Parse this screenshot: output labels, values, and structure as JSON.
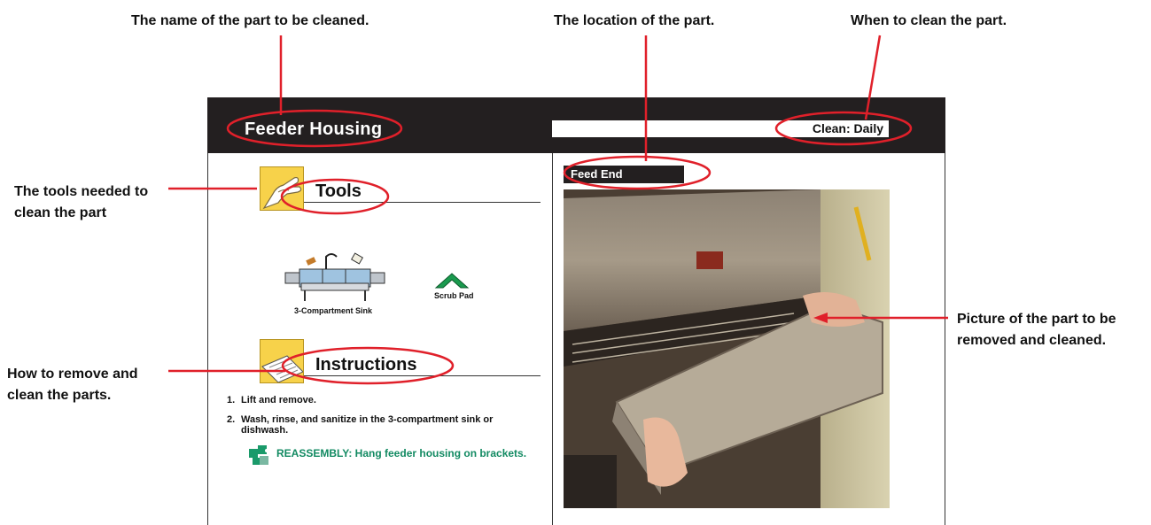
{
  "callouts": {
    "part_name": "The name of the part to be cleaned.",
    "location": "The location of the part.",
    "when": "When to clean the part.",
    "tools_line1": "The tools needed to",
    "tools_line2": "clean the part",
    "how_line1": "How to remove and",
    "how_line2": "clean the parts.",
    "picture_line1": "Picture of the part to be",
    "picture_line2": "removed and cleaned."
  },
  "card": {
    "title": "Feeder Housing",
    "clean": "Clean: Daily",
    "location_label": "Feed End",
    "tools_heading": "Tools",
    "tools": [
      "3-Compartment Sink",
      "Scrub Pad"
    ],
    "instructions_heading": "Instructions",
    "steps": [
      {
        "num": "1.",
        "text": "Lift and remove."
      },
      {
        "num": "2.",
        "text": "Wash, rinse, and sanitize in the 3-compartment sink or dishwash."
      }
    ],
    "reassembly": "REASSEMBLY: Hang feeder housing on brackets."
  },
  "colors": {
    "highlight": "#e0202a",
    "header_bg": "#231f20",
    "reassembly_text": "#128a62",
    "icon_yellow": "#f7d24a"
  }
}
